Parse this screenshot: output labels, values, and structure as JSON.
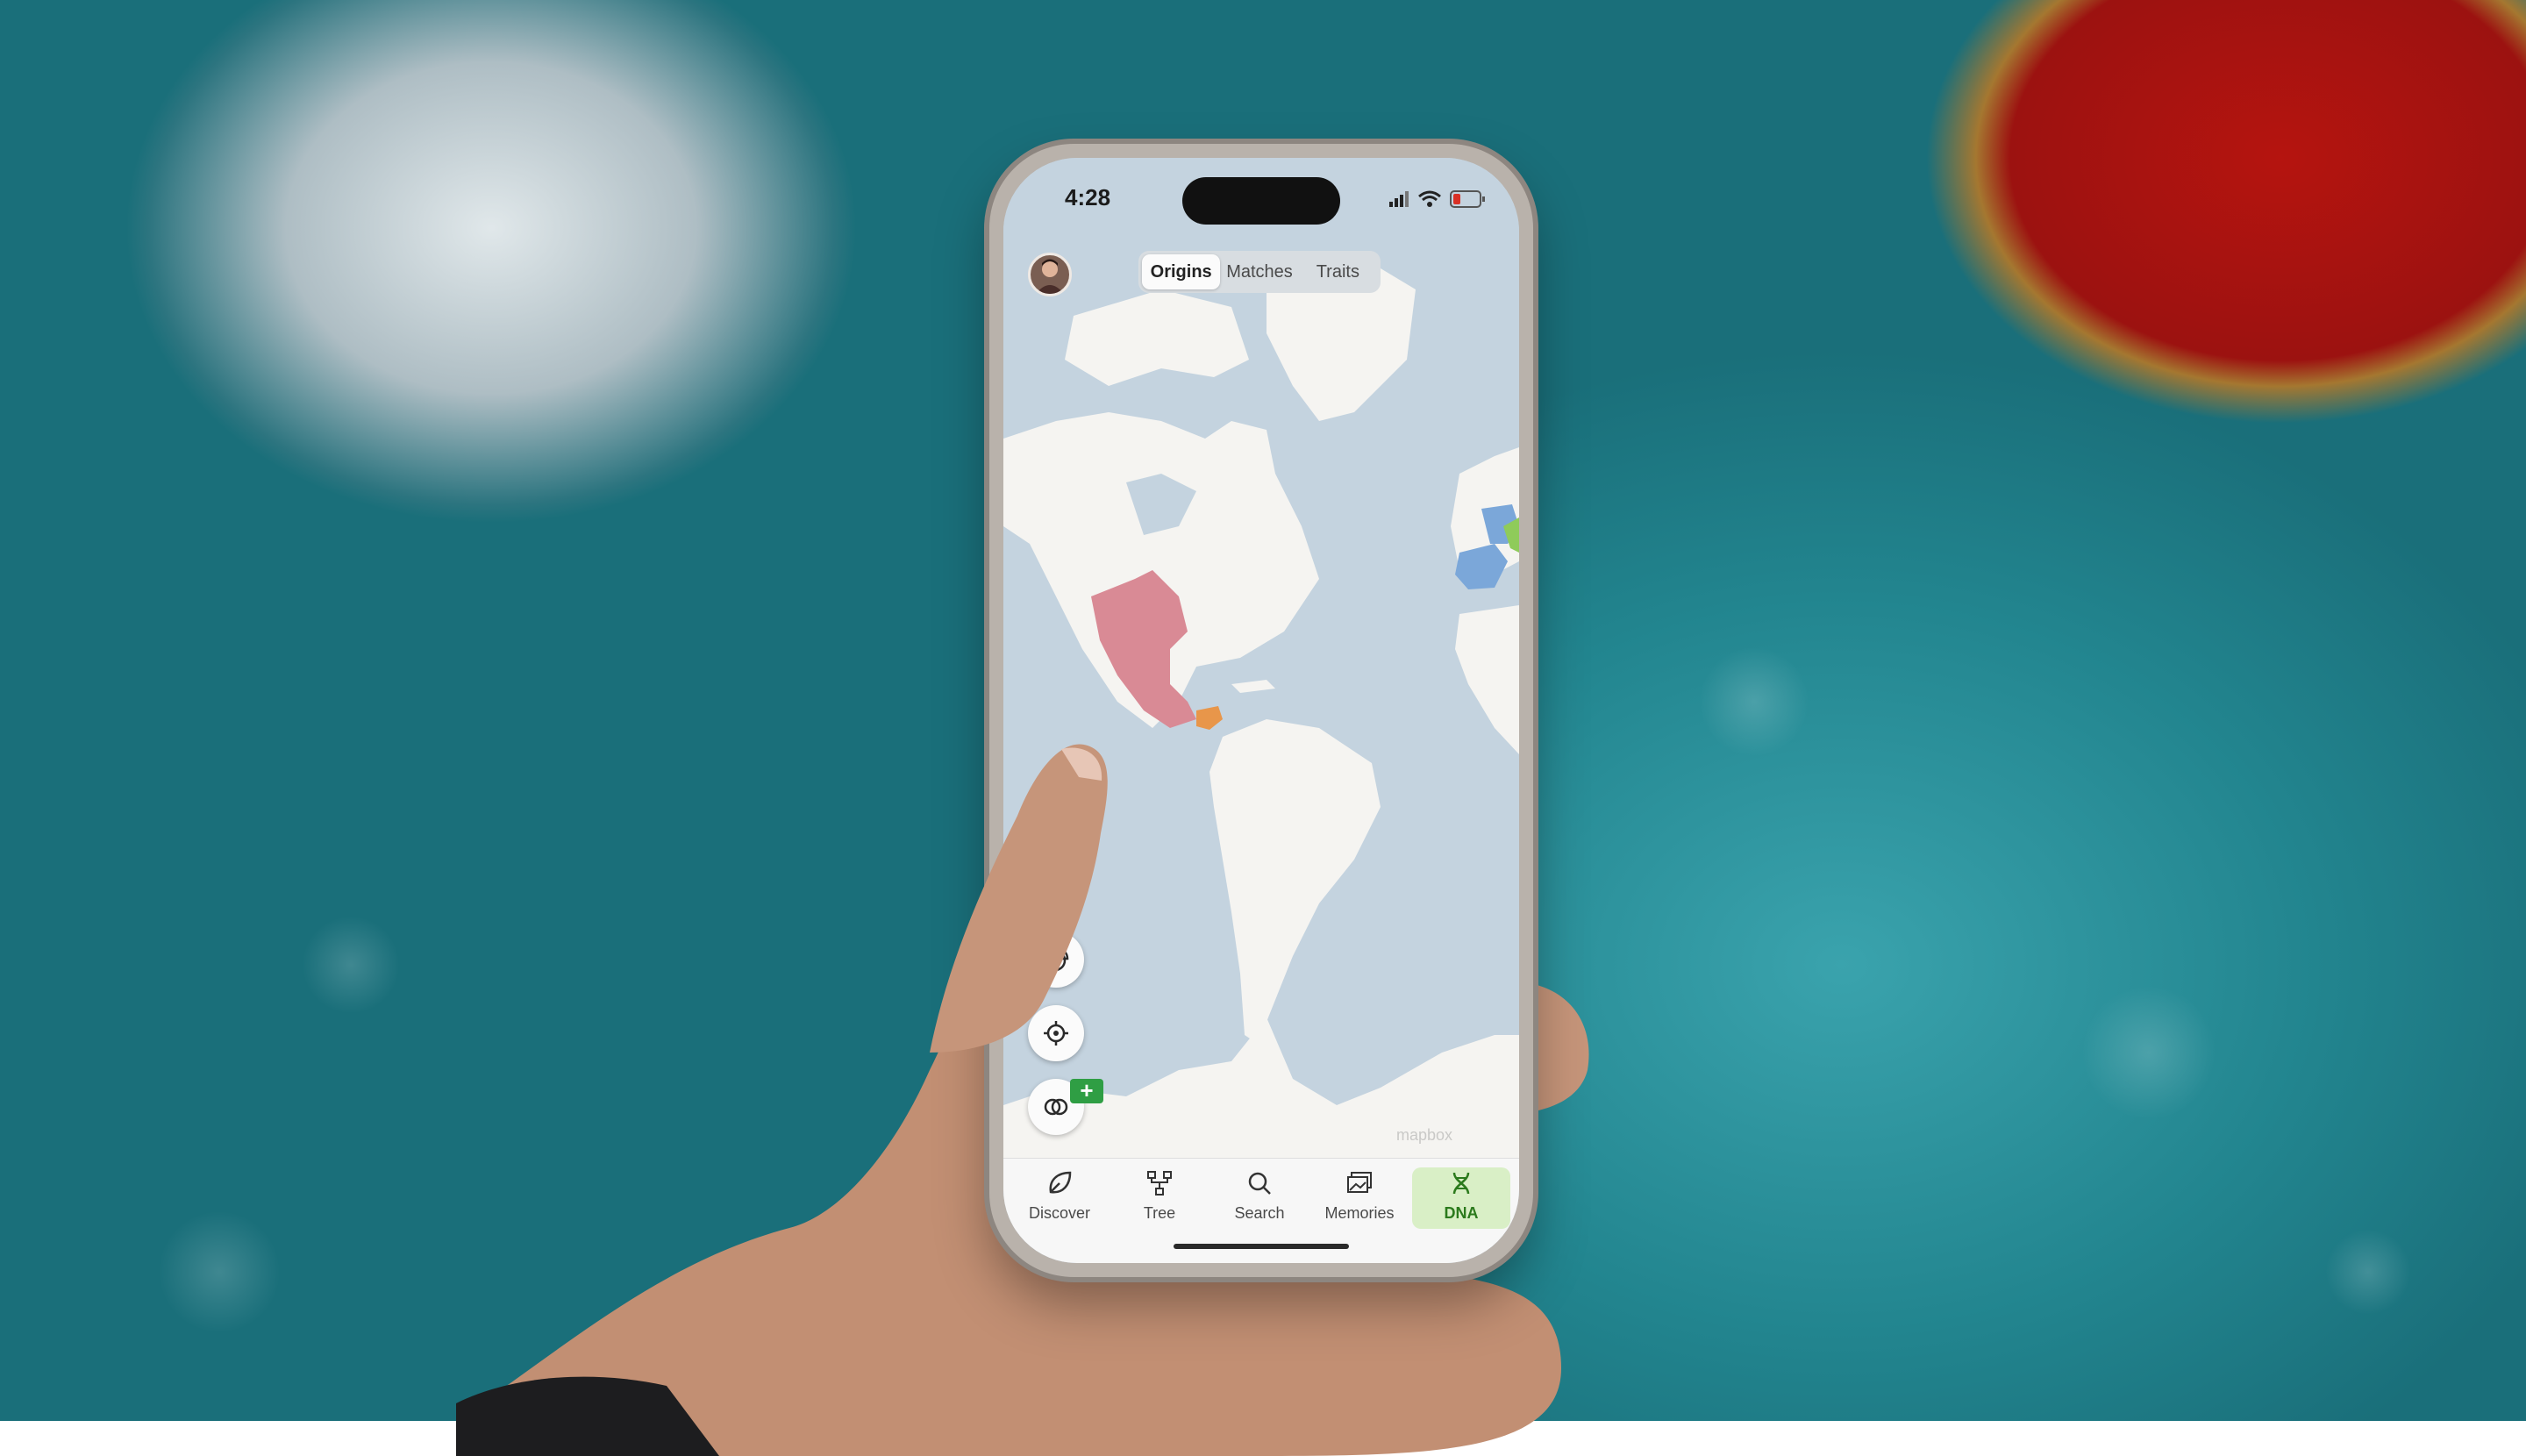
{
  "status_bar": {
    "time": "4:28",
    "signal_icon": "signal-bars-icon",
    "wifi_icon": "wifi-icon",
    "battery_icon": "battery-low-icon"
  },
  "header": {
    "avatar_icon": "profile-avatar",
    "tabs": [
      {
        "label": "Origins",
        "active": true
      },
      {
        "label": "Matches",
        "active": false
      },
      {
        "label": "Traits",
        "active": false
      }
    ]
  },
  "map": {
    "watermark": "mapbox",
    "highlight_colors": {
      "mexico_region": "#d98a95",
      "central_america_region": "#e8964a",
      "iberia_region": "#7ba7d9",
      "italy_region": "#8fcb5a"
    }
  },
  "map_controls": [
    {
      "icon": "pie-chart-icon"
    },
    {
      "icon": "location-target-icon"
    },
    {
      "icon": "linked-rings-icon",
      "badge": "+"
    }
  ],
  "bottom_nav": {
    "items": [
      {
        "label": "Discover",
        "icon": "leaf-icon"
      },
      {
        "label": "Tree",
        "icon": "family-tree-icon"
      },
      {
        "label": "Search",
        "icon": "search-icon"
      },
      {
        "label": "Memories",
        "icon": "photos-icon"
      },
      {
        "label": "DNA",
        "icon": "dna-icon",
        "active": true
      }
    ],
    "accent_color": "#2b7a1c"
  }
}
